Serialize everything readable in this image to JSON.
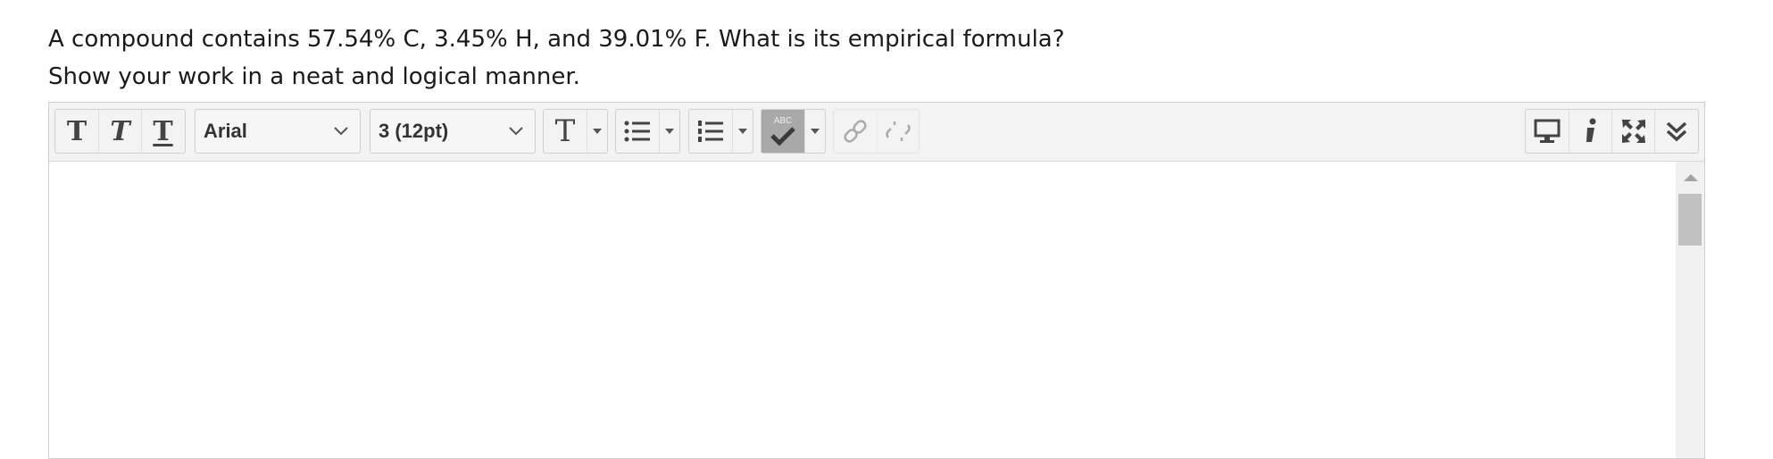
{
  "question": {
    "line1": "A compound contains 57.54% C, 3.45% H, and 39.01% F. What is its empirical formula?",
    "line2": "Show your work in a neat and logical manner."
  },
  "toolbar": {
    "format_buttons": [
      {
        "label": "T",
        "name": "bold-button"
      },
      {
        "label": "T",
        "name": "italic-button"
      },
      {
        "label": "T",
        "name": "underline-button"
      }
    ],
    "font_family": {
      "value": "Arial"
    },
    "font_size": {
      "value": "3 (12pt)"
    },
    "text_color_label": "T",
    "spellcheck_label": "ABC"
  },
  "colors": {
    "toolbar_bg": "#f3f3f3",
    "spellcheck_active": "#a9a9a9",
    "icon": "#444444"
  }
}
